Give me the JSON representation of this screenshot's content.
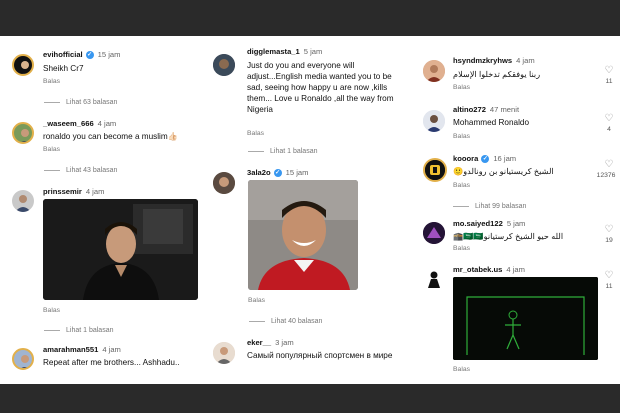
{
  "columns": [
    {
      "comments": [
        {
          "user": "evihofficial",
          "verified": true,
          "time": "15 jam",
          "text": "Sheikh Cr7",
          "reply": "Balas",
          "view_replies": "Lihat 63 balasan"
        },
        {
          "user": "_waseem_666",
          "verified": false,
          "time": "4 jam",
          "text": "ronaldo you can become a muslim👍🏻",
          "reply": "Balas",
          "view_replies": "Lihat 43 balasan"
        },
        {
          "user": "prinssemir",
          "verified": false,
          "time": "4 jam",
          "text": "",
          "reply": "Balas",
          "view_replies": "Lihat 1 balasan"
        },
        {
          "user": "amarahman551",
          "verified": false,
          "time": "4 jam",
          "text": "Repeat after me brothers... Ashhadu..",
          "reply": "",
          "view_replies": ""
        }
      ]
    },
    {
      "comments": [
        {
          "user": "digglemasta_1",
          "verified": false,
          "time": "5 jam",
          "text": "Just do you and everyone will adjust...English media wanted you to be sad, seeing how happy u are now ,kills them... Love u Ronaldo ,all the way from Nigeria",
          "reply": "Balas",
          "view_replies": "Lihat 1 balasan"
        },
        {
          "user": "3ala2o",
          "verified": true,
          "time": "15 jam",
          "text": "",
          "reply": "Balas",
          "view_replies": "Lihat 40 balasan"
        },
        {
          "user": "eker__",
          "verified": false,
          "time": "3 jam",
          "text": "Самый популярный спортсмен в мире",
          "reply": "",
          "view_replies": ""
        }
      ]
    },
    {
      "comments": [
        {
          "user": "hsyndmzkryhws",
          "verified": false,
          "time": "4 jam",
          "text": "ربنا يوفقكم تدخلوا الإسلام",
          "reply": "Balas",
          "likes": "11",
          "view_replies": ""
        },
        {
          "user": "altino272",
          "verified": false,
          "time": "47 menit",
          "text": "Mohammed Ronaldo",
          "reply": "Balas",
          "likes": "4",
          "view_replies": ""
        },
        {
          "user": "kooora",
          "verified": true,
          "time": "16 jam",
          "text": "الشيخ كريستيانو بن رونالدو🙂",
          "reply": "Balas",
          "likes": "12376",
          "view_replies": "Lihat 99 balasan"
        },
        {
          "user": "mo.saiyed122",
          "verified": false,
          "time": "5 jam",
          "text": "الله حيو الشيخ كرستيانو🇸🇦🇸🇦🕋",
          "reply": "Balas",
          "likes": "19",
          "view_replies": ""
        },
        {
          "user": "mr_otabek.us",
          "verified": false,
          "time": "4 jam",
          "text": "",
          "reply": "Balas",
          "likes": "11",
          "view_replies": ""
        }
      ]
    }
  ],
  "colors": {
    "verified": "#3897f0",
    "frame": "#2a2a2a",
    "muted": "#777777"
  }
}
